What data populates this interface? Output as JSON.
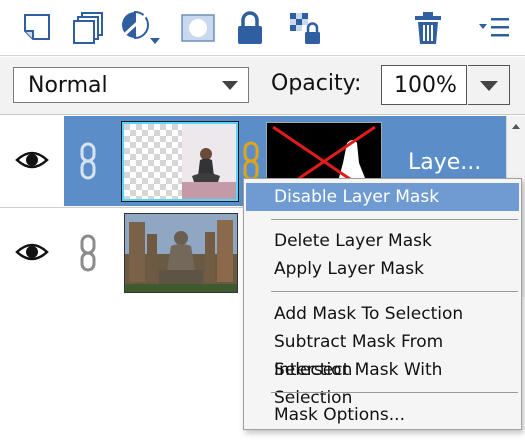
{
  "toolbar": {
    "buttons": [
      {
        "name": "new-layer-icon"
      },
      {
        "name": "layer-stack-icon"
      },
      {
        "name": "fill-adjustment-icon"
      },
      {
        "name": "layer-mask-icon"
      },
      {
        "name": "lock-icon"
      },
      {
        "name": "lock-transparency-icon"
      },
      {
        "name": "trash-icon"
      },
      {
        "name": "panel-menu-icon"
      }
    ]
  },
  "controls": {
    "blend_mode": "Normal",
    "opacity_label": "Opacity:",
    "opacity_value": "100%"
  },
  "layers": [
    {
      "name_label": "Laye...",
      "selected": true,
      "has_mask": true,
      "visible": true
    },
    {
      "name_label": "",
      "selected": false,
      "has_mask": false,
      "visible": true
    }
  ],
  "context_menu": {
    "items": [
      {
        "label": "Disable Layer Mask",
        "highlighted": true
      },
      {
        "label": "Delete Layer Mask"
      },
      {
        "label": "Apply Layer Mask"
      },
      {
        "label": "Add Mask To Selection"
      },
      {
        "label": "Subtract Mask From Selection"
      },
      {
        "label": "Intersect Mask With Selection"
      },
      {
        "label": "Mask Options..."
      }
    ]
  },
  "colors": {
    "selection": "#5b8ec9",
    "menu_highlight": "#6f9bd2",
    "icon_blue": "#2f5fa0",
    "link_gold": "#e0a418"
  }
}
